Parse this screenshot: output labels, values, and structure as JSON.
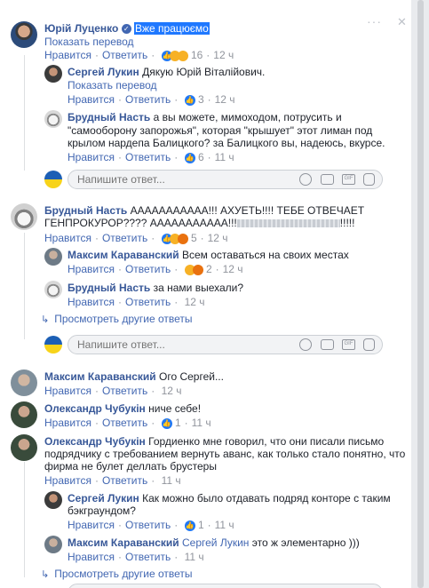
{
  "actions": {
    "like": "Нравится",
    "reply": "Ответить",
    "more_replies": "Просмотреть другие ответы",
    "reply_placeholder": "Напишите ответ...",
    "translate": "Показать перевод"
  },
  "c1": {
    "author": "Юрій Луценко",
    "text_hl": "Вже працюємо",
    "reactions": "16",
    "time": "12 ч",
    "r1": {
      "author": "Сергей Лукин",
      "text": "Дякую Юрій Віталійович.",
      "reactions": "3",
      "time": "12 ч"
    },
    "r2": {
      "author": "Брудный Насть",
      "text_a": "а вы можете, мимоходом, потрусить и",
      "text_b": "\"самооборону запорожья\", которая \"крышует\" этот лиман под",
      "text_c": "крылом нардепа Балицкого? за Балицкого вы, надеюсь, вкурсе.",
      "reactions": "6",
      "time": "11 ч"
    }
  },
  "c2": {
    "author": "Брудный Насть",
    "text_a": "ААААААААААА!!! АХУЕТЬ!!!! ТЕБЕ ОТВЕЧАЕТ",
    "text_b": "ГЕНПРОКУРОР???? ААААААААААА!!!",
    "text_end": "!!!!!",
    "reactions": "5",
    "time": "12 ч",
    "r1": {
      "author": "Максим Караванский",
      "text": "Всем оставаться на своих местах",
      "reactions": "2",
      "time": "12 ч"
    },
    "r2": {
      "author": "Брудный Насть",
      "text": "за нами выехали?",
      "time": "12 ч"
    }
  },
  "c3": {
    "author": "Максим Караванский",
    "text": "Ого Сергей...",
    "time": "12 ч"
  },
  "c4": {
    "author": "Олександр Чубукін",
    "text": "ниче себе!",
    "reactions": "1",
    "time": "11 ч"
  },
  "c5": {
    "author": "Олександр Чубукін",
    "text_a": "Гордиенко мне говорил, что они писали письмо",
    "text_b": "подрядчику с требованием вернуть аванс, как только стало понятно, что",
    "text_c": "фирма не булет деллать брустеры",
    "time": "11 ч",
    "r1": {
      "author": "Сергей Лукин",
      "text_a": "Как можно было отдавать подряд конторе с таким",
      "text_b": "бэкграундом?",
      "reactions": "1",
      "time": "11 ч"
    },
    "r2": {
      "author": "Максим Караванский",
      "mention": "Сергей Лукин",
      "text": "это ж элементарно )))",
      "time": "11 ч"
    }
  },
  "colors": {
    "link": "#385898",
    "action": "#4267b2",
    "meta": "#90949c",
    "like_blue": "#2078f4",
    "laugh_yellow": "#f7b125"
  }
}
